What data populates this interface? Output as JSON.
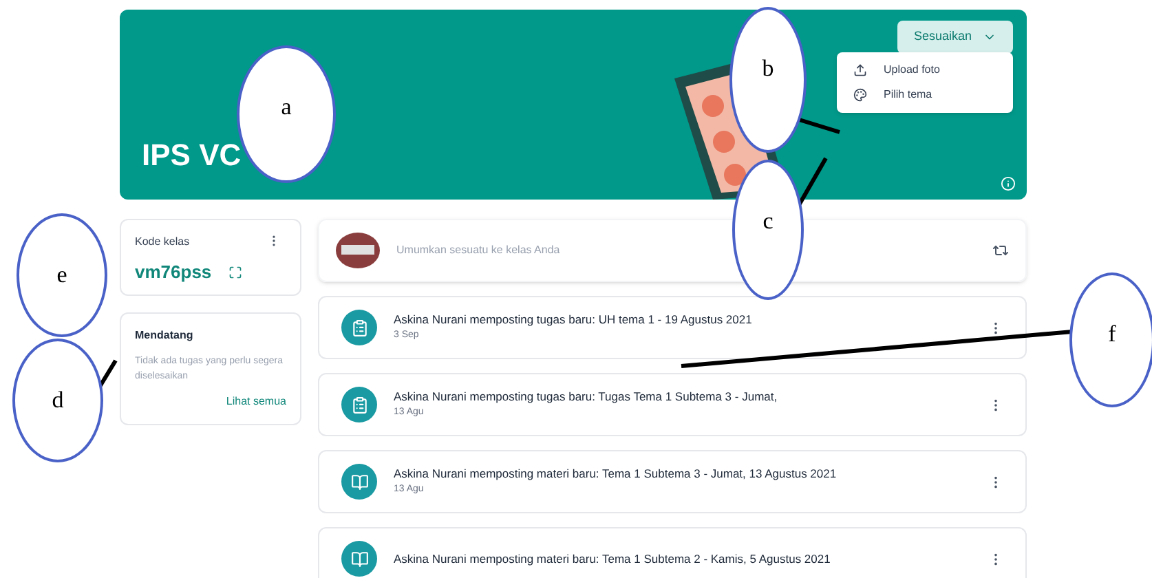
{
  "banner": {
    "title": "IPS VC",
    "customize_button": "Sesuaikan",
    "menu": [
      {
        "kind": "upload",
        "label": "Upload foto"
      },
      {
        "kind": "theme",
        "label": "Pilih tema"
      }
    ]
  },
  "class_code": {
    "label": "Kode kelas",
    "code": "vm76pss"
  },
  "upcoming": {
    "title": "Mendatang",
    "message": "Tidak ada tugas yang perlu segera diselesaikan",
    "link": "Lihat semua"
  },
  "announce": {
    "placeholder": "Umumkan sesuatu ke kelas Anda"
  },
  "posts": [
    {
      "kind": "assignment",
      "text": "Askina Nurani memposting tugas baru: UH tema 1 - 19 Agustus 2021",
      "date": "3 Sep"
    },
    {
      "kind": "assignment",
      "text": "Askina Nurani memposting tugas baru: Tugas Tema 1 Subtema 3 - Jumat,",
      "date": "13 Agu"
    },
    {
      "kind": "material",
      "text": "Askina Nurani memposting materi baru: Tema 1 Subtema 3 - Jumat, 13 Agustus 2021",
      "date": "13 Agu"
    },
    {
      "kind": "material",
      "text": "Askina Nurani memposting materi baru: Tema 1 Subtema 2 - Kamis, 5 Agustus 2021"
    }
  ],
  "annotations": [
    {
      "label": "a"
    },
    {
      "label": "b"
    },
    {
      "label": "c"
    },
    {
      "label": "e"
    },
    {
      "label": "d"
    },
    {
      "label": "f"
    }
  ]
}
